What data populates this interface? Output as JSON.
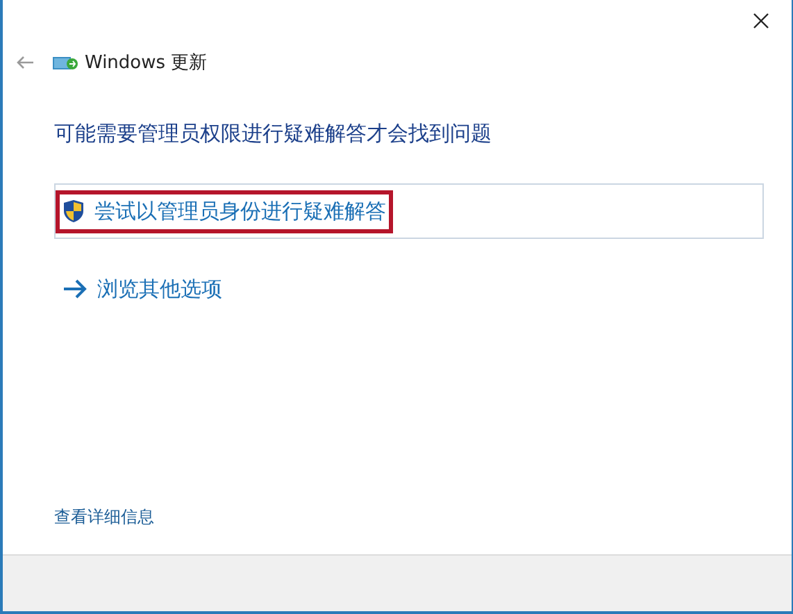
{
  "window": {
    "title": "Windows 更新"
  },
  "heading": "可能需要管理员权限进行疑难解答才会找到问题",
  "options": [
    {
      "kind": "admin",
      "label": "尝试以管理员身份进行疑难解答",
      "highlighted": true
    },
    {
      "kind": "arrow",
      "label": "浏览其他选项",
      "highlighted": false
    }
  ],
  "details_link": "查看详细信息"
}
